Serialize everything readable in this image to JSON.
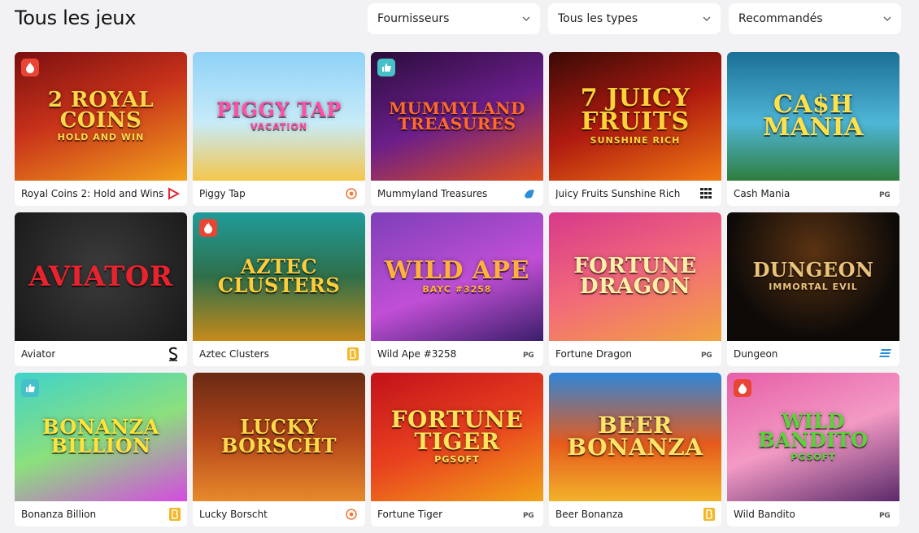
{
  "page": {
    "title": "Tous les jeux"
  },
  "filters": [
    {
      "label": "Fournisseurs",
      "icon": "chevron-down-icon"
    },
    {
      "label": "Tous les types",
      "icon": "chevron-down-icon"
    },
    {
      "label": "Recommandés",
      "icon": "chevron-down-icon"
    }
  ],
  "colors": {
    "fire_badge": "#e84535",
    "like_badge": "#46c0c9",
    "background": "#f2f2f4"
  },
  "games": [
    {
      "name": "Royal Coins 2: Hold and Wins",
      "art_title": "2 ROYAL COINS",
      "art_sub": "HOLD AND WIN",
      "badge": "fire",
      "provider_icon": "play-triangle-icon",
      "bg": "linear-gradient(160deg,#7a1010,#c8321a 45%,#f2a21c)",
      "fg": "#ffd84a"
    },
    {
      "name": "Piggy Tap",
      "art_title": "PIGGY TAP",
      "art_sub": "Vacation",
      "badge": "",
      "provider_icon": "target-icon",
      "bg": "linear-gradient(180deg,#8fd2f7,#c7ebf8 55%,#f4c64b)",
      "fg": "#ff4fa8"
    },
    {
      "name": "Mummyland Treasures",
      "art_title": "MUMMYLAND TREASURES",
      "art_sub": "",
      "badge": "like",
      "provider_icon": "drop-icon",
      "bg": "linear-gradient(160deg,#2a0d3a,#6a1e8a 50%,#e0501c)",
      "fg": "#ff6a2a"
    },
    {
      "name": "Juicy Fruits Sunshine Rich",
      "art_title": "7 Juicy Fruits",
      "art_sub": "Sunshine Rich",
      "badge": "",
      "provider_icon": "grid-icon",
      "bg": "linear-gradient(160deg,#3a0a06,#b01b10 50%,#f07a12)",
      "fg": "#ffd23a"
    },
    {
      "name": "Cash Mania",
      "art_title": "CA$H Mania",
      "art_sub": "",
      "badge": "",
      "provider_icon": "pg-logo-icon",
      "bg": "linear-gradient(180deg,#1b6f96,#4fb6d7 55%,#2f7d3d)",
      "fg": "#ffe14a"
    },
    {
      "name": "Aviator",
      "art_title": "Aviator",
      "art_sub": "",
      "badge": "",
      "provider_icon": "s-logo-icon",
      "bg": "radial-gradient(circle at 50% 45%,#3c3c3c,#181818)",
      "fg": "#e8232e"
    },
    {
      "name": "Aztec Clusters",
      "art_title": "AZTEC CLUSTERS",
      "art_sub": "",
      "badge": "fire",
      "provider_icon": "b-logo-icon",
      "bg": "linear-gradient(180deg,#1f9c9a,#2f6f4a 50%,#c58a1a)",
      "fg": "#ffcd3a"
    },
    {
      "name": "Wild Ape #3258",
      "art_title": "Wild APE",
      "art_sub": "BAYC #3258",
      "badge": "",
      "provider_icon": "pg-logo-icon",
      "bg": "linear-gradient(160deg,#7d3fb8,#c14fd6 55%,#3b1e6a)",
      "fg": "#ffb13a"
    },
    {
      "name": "Fortune Dragon",
      "art_title": "FORTUNE Dragon",
      "art_sub": "",
      "badge": "",
      "provider_icon": "pg-logo-icon",
      "bg": "linear-gradient(160deg,#d7398a,#f26a7a 50%,#f1a33f)",
      "fg": "#fff0a8"
    },
    {
      "name": "Dungeon",
      "art_title": "DUNGEON",
      "art_sub": "IMMORTAL EVIL",
      "badge": "",
      "provider_icon": "stripes-logo-icon",
      "bg": "radial-gradient(circle at 50% 30%,#5a3312,#0d0a08 70%)",
      "fg": "#e9c27b"
    },
    {
      "name": "Bonanza Billion",
      "art_title": "BONANZA BILLION",
      "art_sub": "",
      "badge": "like",
      "provider_icon": "b-logo-icon",
      "bg": "linear-gradient(160deg,#3fd3c9,#8be07d 50%,#d44be0)",
      "fg": "#ffe23a"
    },
    {
      "name": "Lucky Borscht",
      "art_title": "LUCKY BORSCHT",
      "art_sub": "",
      "badge": "",
      "provider_icon": "target-icon",
      "bg": "linear-gradient(180deg,#6a2a14,#b3461a 50%,#e8892b)",
      "fg": "#ffd94a"
    },
    {
      "name": "Fortune Tiger",
      "art_title": "FORTUNE TIGER",
      "art_sub": "PGSoft",
      "badge": "",
      "provider_icon": "pg-logo-icon",
      "bg": "linear-gradient(160deg,#c1121a,#e8401f 50%,#f2a218)",
      "fg": "#ffe35a"
    },
    {
      "name": "Beer Bonanza",
      "art_title": "BEER BONANZA",
      "art_sub": "",
      "badge": "",
      "provider_icon": "b-logo-icon",
      "bg": "linear-gradient(180deg,#2f86d8,#e65a1c 55%,#f2b22a)",
      "fg": "#ffe46a"
    },
    {
      "name": "Wild Bandito",
      "art_title": "WILD BANDITO",
      "art_sub": "PGSoft",
      "badge": "fire",
      "provider_icon": "pg-logo-icon",
      "bg": "linear-gradient(160deg,#e65fa8,#f39ac4 50%,#5a2a6a)",
      "fg": "#5bd23a"
    }
  ]
}
